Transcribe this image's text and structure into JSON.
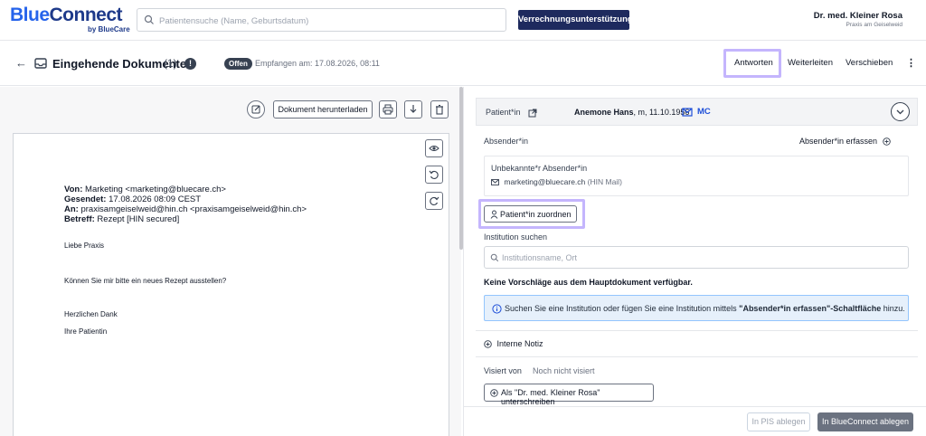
{
  "app": {
    "logo": "BlueConnect",
    "logo_sub": "by BlueCare"
  },
  "topbar": {
    "search_placeholder": "Patientensuche (Name, Geburtsdatum)",
    "billing_button": "Verrechnungsunterstützung",
    "user_name": "Dr. med. Kleiner Rosa",
    "user_practice": "Praxis am Geiselweid"
  },
  "header": {
    "title": "Eingehende Dokumente",
    "count": "(1)",
    "status_badge": "Offen",
    "received": "Empfangen am: 17.08.2026, 08:11",
    "reply": "Antworten",
    "forward": "Weiterleiten",
    "move": "Verschieben"
  },
  "viewer": {
    "download_label": "Dokument herunterladen",
    "email": {
      "from_label": "Von:",
      "from_value": "Marketing <marketing@bluecare.ch>",
      "sent_label": "Gesendet:",
      "sent_value": "17.08.2026 08:09 CEST",
      "to_label": "An:",
      "to_value": "praxisamgeiselweid@hin.ch <praxisamgeiselweid@hin.ch>",
      "subject_label": "Betreff:",
      "subject_value": "Rezept [HIN secured]",
      "greeting": "Liebe Praxis",
      "body": "Können Sie mir bitte ein neues Rezept ausstellen?",
      "closing": "Herzlichen Dank",
      "signature": "Ihre Patientin"
    }
  },
  "panel": {
    "patient_label": "Patient*in",
    "patient_name": "Anemone Hans",
    "patient_details": ", m, 11.10.1956",
    "patient_tag": "MC",
    "sender_label": "Absender*in",
    "capture_sender": "Absender*in erfassen",
    "unknown_sender": "Unbekannte*r Absender*in",
    "sender_email": "marketing@bluecare.ch",
    "sender_email_note": "(HIN Mail)",
    "assign_patient": "Patient*in zuordnen",
    "institution_label": "Institution suchen",
    "institution_placeholder": "Institutionsname, Ort",
    "no_suggestions": "Keine Vorschläge aus dem Hauptdokument verfügbar.",
    "info_pre": "Suchen Sie eine Institution oder fügen Sie eine Institution mittels ",
    "info_bold": "\"Absender*in erfassen\"-Schaltfläche",
    "info_post": " hinzu.",
    "internal_note": "Interne Notiz",
    "visa_label": "Visiert von",
    "visa_value": "Noch nicht visiert",
    "sign_button": "Als \"Dr. med. Kleiner Rosa\" unterschreiben"
  },
  "footer": {
    "file_pis": "In PIS ablegen",
    "file_bc": "In BlueConnect ablegen"
  },
  "colors": {
    "brand": "#1e3a8a",
    "accent": "#2563eb",
    "highlight": "#c4b5fd",
    "info_bg": "#e6f0fb"
  }
}
